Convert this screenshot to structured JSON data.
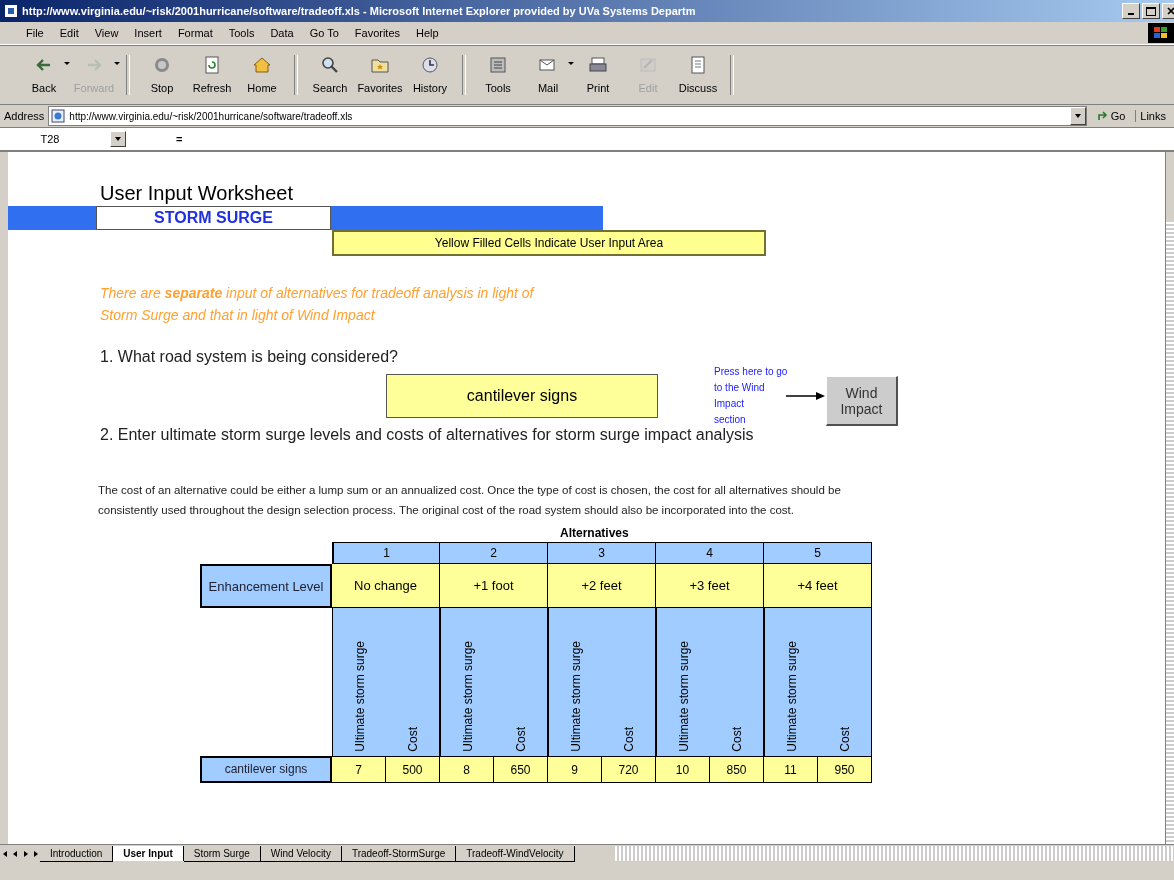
{
  "window": {
    "title": "http://www.virginia.edu/~risk/2001hurricane/software/tradeoff.xls - Microsoft Internet Explorer provided by UVa Systems Departm"
  },
  "menu_bar": [
    "File",
    "Edit",
    "View",
    "Insert",
    "Format",
    "Tools",
    "Data",
    "Go To",
    "Favorites",
    "Help"
  ],
  "toolbar": [
    {
      "label": "Back",
      "disabled": false,
      "dropdown": true
    },
    {
      "label": "Forward",
      "disabled": true,
      "dropdown": true
    },
    {
      "label": "Stop",
      "disabled": false,
      "dropdown": false
    },
    {
      "label": "Refresh",
      "disabled": false,
      "dropdown": false
    },
    {
      "label": "Home",
      "disabled": false,
      "dropdown": false
    },
    {
      "label": "Search",
      "disabled": false,
      "dropdown": false
    },
    {
      "label": "Favorites",
      "disabled": false,
      "dropdown": false
    },
    {
      "label": "History",
      "disabled": false,
      "dropdown": false
    },
    {
      "label": "Tools",
      "disabled": false,
      "dropdown": false
    },
    {
      "label": "Mail",
      "disabled": false,
      "dropdown": true
    },
    {
      "label": "Print",
      "disabled": false,
      "dropdown": false
    },
    {
      "label": "Edit",
      "disabled": true,
      "dropdown": false
    },
    {
      "label": "Discuss",
      "disabled": false,
      "dropdown": false
    }
  ],
  "address_bar": {
    "label": "Address",
    "value": "http://www.virginia.edu/~risk/2001hurricane/software/tradeoff.xls",
    "go": "Go",
    "links": "Links"
  },
  "formula_bar": {
    "cell_ref": "T28",
    "equals": "="
  },
  "sheet": {
    "title": "User Input Worksheet",
    "section_label": "STORM SURGE",
    "note": "Yellow Filled Cells Indicate User Input Area",
    "intro": "There are  **separate**  input of alternatives for tradeoff analysis in light of Storm Surge and that in light of Wind Impact",
    "question_1": "1. What road system  is being considered?",
    "answer_1": "cantilever signs",
    "link_text": [
      "Press here to go",
      "to the Wind Impact",
      "section"
    ],
    "wind_button": "Wind Impact",
    "question_2": "2. Enter ultimate storm surge levels and costs of alternatives for storm surge impact analysis",
    "paragraph": "The cost of an alternative could be either a lump sum or an annualized cost.  Once the type of cost is chosen, the cost for all alternatives should be consistently used throughout the design selection process. The original cost of the road system should also be incorporated into the cost.",
    "table": {
      "group_heading": "Alternatives",
      "row_header": "Enhancement Level",
      "alternatives": [
        {
          "number": "1",
          "level": "No change",
          "columns": [
            "Ultimate storm surge",
            "Cost"
          ]
        },
        {
          "number": "2",
          "level": "+1 foot",
          "columns": [
            "Ultimate storm surge",
            "Cost"
          ]
        },
        {
          "number": "3",
          "level": "+2 feet",
          "columns": [
            "Ultimate storm surge",
            "Cost"
          ]
        },
        {
          "number": "4",
          "level": "+3 feet",
          "columns": [
            "Ultimate storm surge",
            "Cost"
          ]
        },
        {
          "number": "5",
          "level": "+4 feet",
          "columns": [
            "Ultimate storm surge",
            "Cost"
          ]
        }
      ],
      "data_row": {
        "label": "cantilever signs",
        "values": [
          "7",
          "500",
          "8",
          "650",
          "9",
          "720",
          "10",
          "850",
          "11",
          "950"
        ]
      }
    }
  },
  "sheet_tabs": [
    {
      "label": "Introduction",
      "selected": false
    },
    {
      "label": "User Input",
      "selected": true
    },
    {
      "label": "Storm Surge",
      "selected": false
    },
    {
      "label": "Wind Velocity",
      "selected": false
    },
    {
      "label": "Tradeoff-StormSurge",
      "selected": false
    },
    {
      "label": "Tradeoff-WindVelocity",
      "selected": false
    }
  ]
}
